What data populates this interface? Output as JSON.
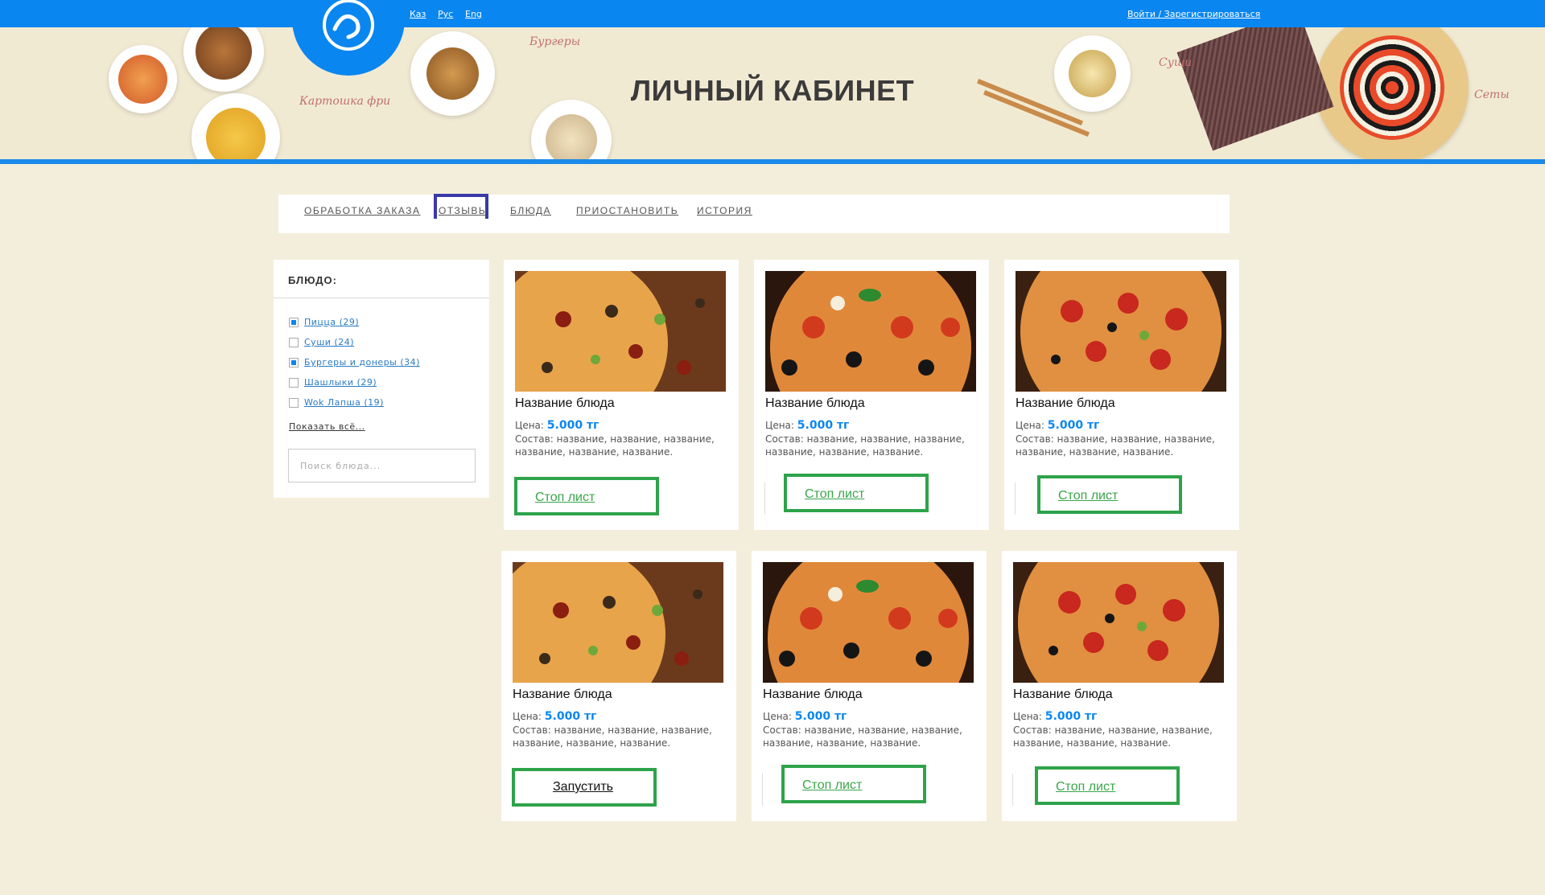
{
  "topbar": {
    "languages": [
      "Каз",
      "Рус",
      "Eng"
    ],
    "login_label": "Войти / Зарегистрироваться"
  },
  "header": {
    "title": "ЛИЧНЫЙ КАБИНЕТ",
    "labels": [
      "Бургеры",
      "Картошка фри",
      "Суши",
      "Сеты"
    ]
  },
  "nav": {
    "items": [
      "ОБРАБОТКА ЗАКАЗА",
      "ОТЗЫВЫ",
      "БЛЮДА",
      "ПРИОСТАНОВИТЬ",
      "ИСТОРИЯ"
    ],
    "active": "ОТЗЫВЫ"
  },
  "sidebar": {
    "title": "БЛЮДО:",
    "filters": [
      {
        "label": "Пицца (29)",
        "checked": true
      },
      {
        "label": "Суши (24)",
        "checked": false
      },
      {
        "label": "Бургеры и донеры (34)",
        "checked": true
      },
      {
        "label": "Шашлыки (29)",
        "checked": false
      },
      {
        "label": "Wok Лапша (19)",
        "checked": false
      }
    ],
    "show_all": "Показать всё...",
    "search_placeholder": "Поиск блюда..."
  },
  "cards": [
    {
      "name": "Название блюда",
      "price_label": "Цена:",
      "price": "5.000 тг",
      "desc": "Состав: название, название, название, название, название, название.",
      "button": "Стоп лист"
    },
    {
      "name": "Название блюда",
      "price_label": "Цена:",
      "price": "5.000 тг",
      "desc": "Состав: название, название, название, название, название, название.",
      "button": "Стоп лист"
    },
    {
      "name": "Название блюда",
      "price_label": "Цена:",
      "price": "5.000 тг",
      "desc": "Состав: название, название, название, название, название, название.",
      "button": "Стоп лист"
    },
    {
      "name": "Название блюда",
      "price_label": "Цена:",
      "price": "5.000 тг",
      "desc": "Состав: название, название, название, название, название, название.",
      "button": "Запустить"
    },
    {
      "name": "Название блюда",
      "price_label": "Цена:",
      "price": "5.000 тг",
      "desc": "Состав: название, название, название, название, название, название.",
      "button": "Стоп лист"
    },
    {
      "name": "Название блюда",
      "price_label": "Цена:",
      "price": "5.000 тг",
      "desc": "Состав: название, название, название, название, название, название.",
      "button": "Стоп лист"
    }
  ],
  "colors": {
    "brand_blue": "#0a86f0",
    "page_bg": "#f3eedb",
    "button_green": "#2ea34a",
    "active_tab": "#3a3aa8"
  }
}
